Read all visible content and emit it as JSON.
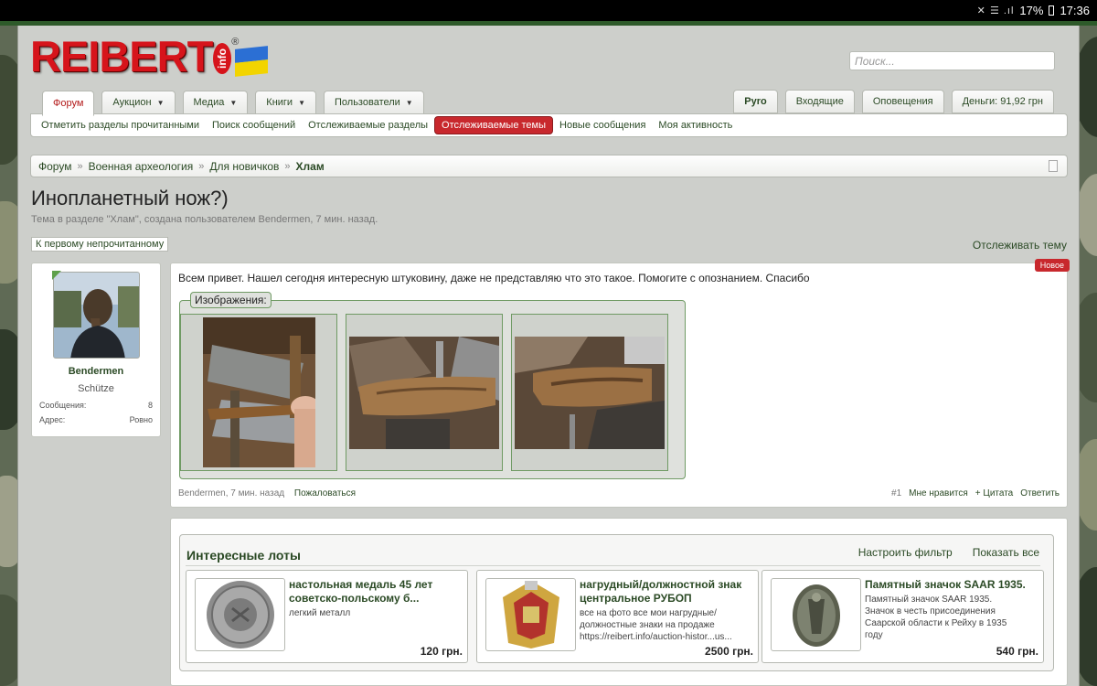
{
  "status_bar": {
    "battery": "17%",
    "time": "17:36"
  },
  "logo": {
    "text": "REIBERT",
    "suffix": "info",
    "reg": "®"
  },
  "search": {
    "placeholder": "Поиск..."
  },
  "nav": {
    "tabs": [
      {
        "label": "Форум",
        "dropdown": false
      },
      {
        "label": "Аукцион",
        "dropdown": true
      },
      {
        "label": "Медиа",
        "dropdown": true
      },
      {
        "label": "Книги",
        "dropdown": true
      },
      {
        "label": "Пользователи",
        "dropdown": true
      }
    ],
    "right_tabs": {
      "user": "Pyro",
      "inbox": "Входящие",
      "alerts": "Оповещения",
      "money": "Деньги: 91,92 грн"
    }
  },
  "subnav": [
    {
      "label": "Отметить разделы прочитанными",
      "highlight": false
    },
    {
      "label": "Поиск сообщений",
      "highlight": false
    },
    {
      "label": "Отслеживаемые разделы",
      "highlight": false
    },
    {
      "label": "Отслеживаемые темы",
      "highlight": true
    },
    {
      "label": "Новые сообщения",
      "highlight": false
    },
    {
      "label": "Моя активность",
      "highlight": false
    }
  ],
  "breadcrumb": [
    "Форум",
    "Военная археология",
    "Для новичков",
    "Хлам"
  ],
  "thread": {
    "title": "Инопланетный нож?)",
    "subtitle": "Тема в разделе \"Хлам\", создана пользователем Bendermen, 7 мин. назад.",
    "first_unread": "К первому непрочитанному",
    "watch": "Отслеживать тему"
  },
  "user": {
    "name": "Bendermen",
    "rank": "Schütze",
    "messages_label": "Сообщения:",
    "messages_value": "8",
    "address_label": "Адрес:",
    "address_value": "Ровно"
  },
  "post": {
    "badge": "Новое",
    "text": "Всем привет. Нашел сегодня интересную штуковину, даже не представляю что это такое. Помогите с опознанием. Спасибо",
    "attachments_label": "Изображения:",
    "author_time": "Bendermen, 7 мин. назад",
    "report": "Пожаловаться",
    "number": "#1",
    "like": "Мне нравится",
    "quote": "+ Цитата",
    "reply": "Ответить"
  },
  "lots": {
    "title": "Интересные лоты",
    "filter": "Настроить фильтр",
    "show_all": "Показать все",
    "items": [
      {
        "title_l1": "настольная медаль 45 лет",
        "title_l2": "советско-польскому б...",
        "desc": [
          "легкий металл"
        ],
        "price": "120 грн."
      },
      {
        "title_l1": "нагрудный/должностной знак",
        "title_l2": "центральное РУБОП",
        "desc": [
          "все на фото все мои нагрудные/",
          "должностные знаки на продаже",
          "https://reibert.info/auction-histor...us..."
        ],
        "price": "2500 грн."
      },
      {
        "title_l1": "Памятный значок SAAR 1935.",
        "title_l2": "",
        "desc": [
          "Памятный значок SAAR 1935.",
          "Значок в честь присоединения",
          "Саарской области к Рейху в 1935",
          "году"
        ],
        "price": "540 грн."
      }
    ]
  }
}
